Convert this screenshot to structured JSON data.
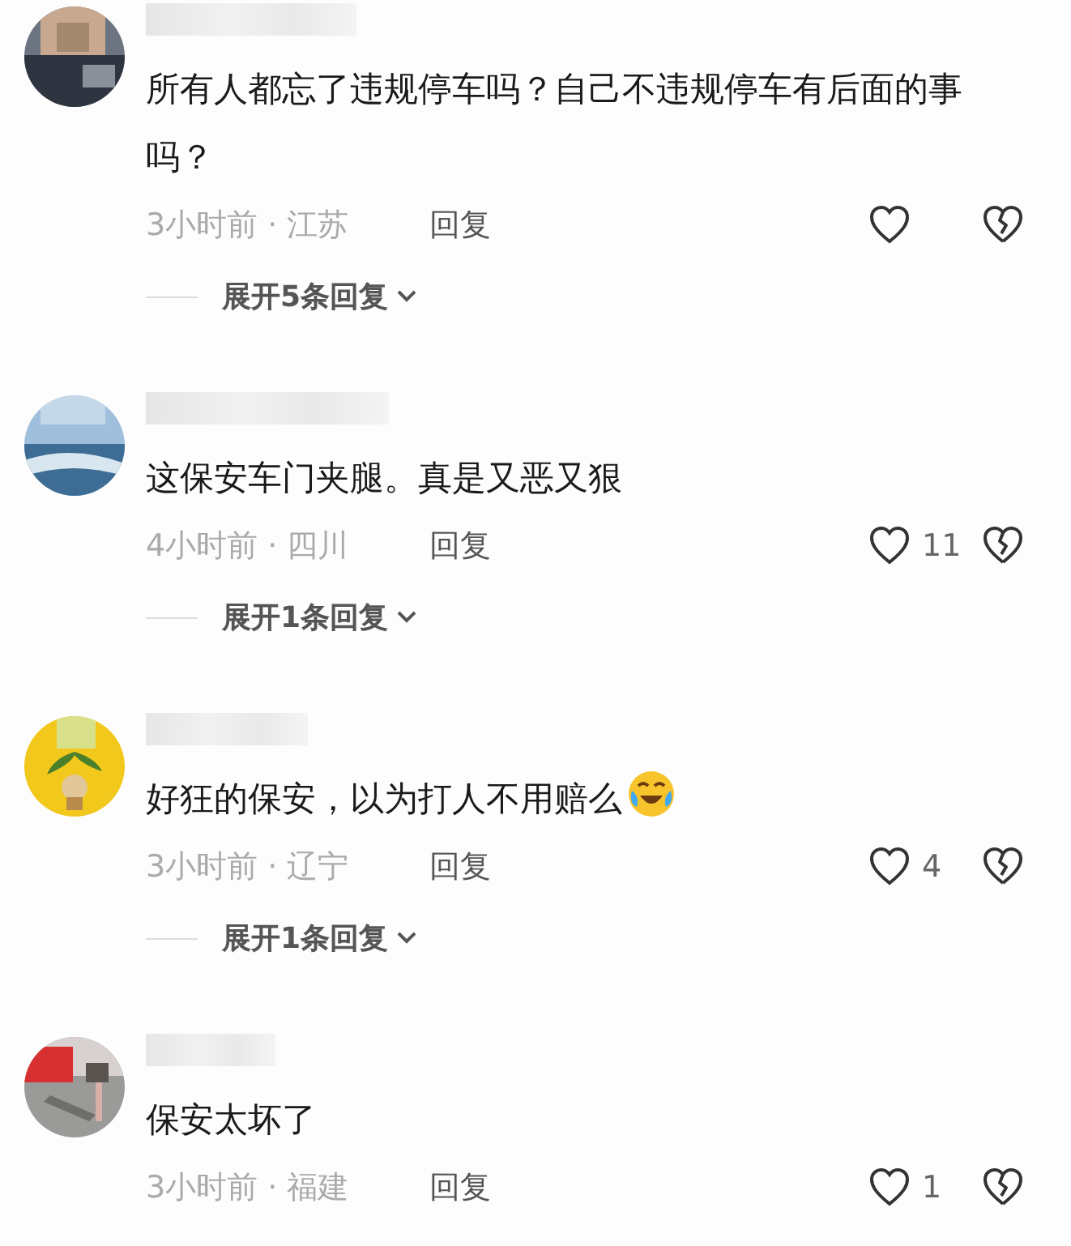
{
  "comments": [
    {
      "text": "所有人都忘了违规停车吗？自己不违规停车有后面的事吗？",
      "has_emoji": false,
      "time": "3小时前 · 江苏",
      "reply": "回复",
      "expand": "展开5条回复"
    },
    {
      "text": "这保安车门夹腿。真是又恶又狠",
      "has_emoji": false,
      "time": "4小时前 · 四川",
      "reply": "回复",
      "likes": "11",
      "expand": "展开1条回复"
    },
    {
      "text": "好狂的保安，以为打人不用赔么",
      "has_emoji": true,
      "time": "3小时前 · 辽宁",
      "reply": "回复",
      "likes": "4",
      "expand": "展开1条回复"
    },
    {
      "text": "保安太坏了",
      "has_emoji": false,
      "time": "3小时前 · 福建",
      "reply": "回复",
      "likes": "1"
    }
  ]
}
